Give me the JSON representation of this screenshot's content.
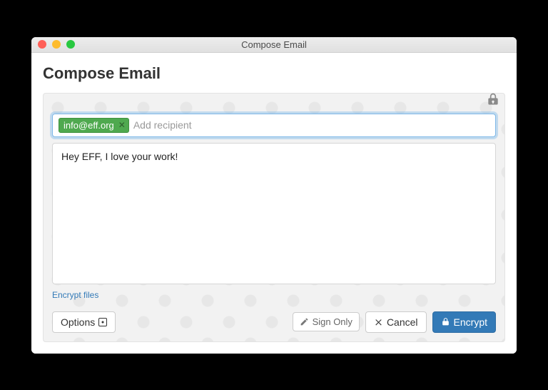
{
  "window": {
    "title": "Compose Email"
  },
  "header": {
    "title": "Compose Email"
  },
  "recipients": {
    "chips": [
      {
        "email": "info@eff.org"
      }
    ],
    "placeholder": "Add recipient"
  },
  "body": {
    "text": "Hey EFF, I love your work!"
  },
  "links": {
    "encrypt_files": "Encrypt files"
  },
  "footer": {
    "options": "Options",
    "sign_only": "Sign Only",
    "cancel": "Cancel",
    "encrypt": "Encrypt"
  }
}
